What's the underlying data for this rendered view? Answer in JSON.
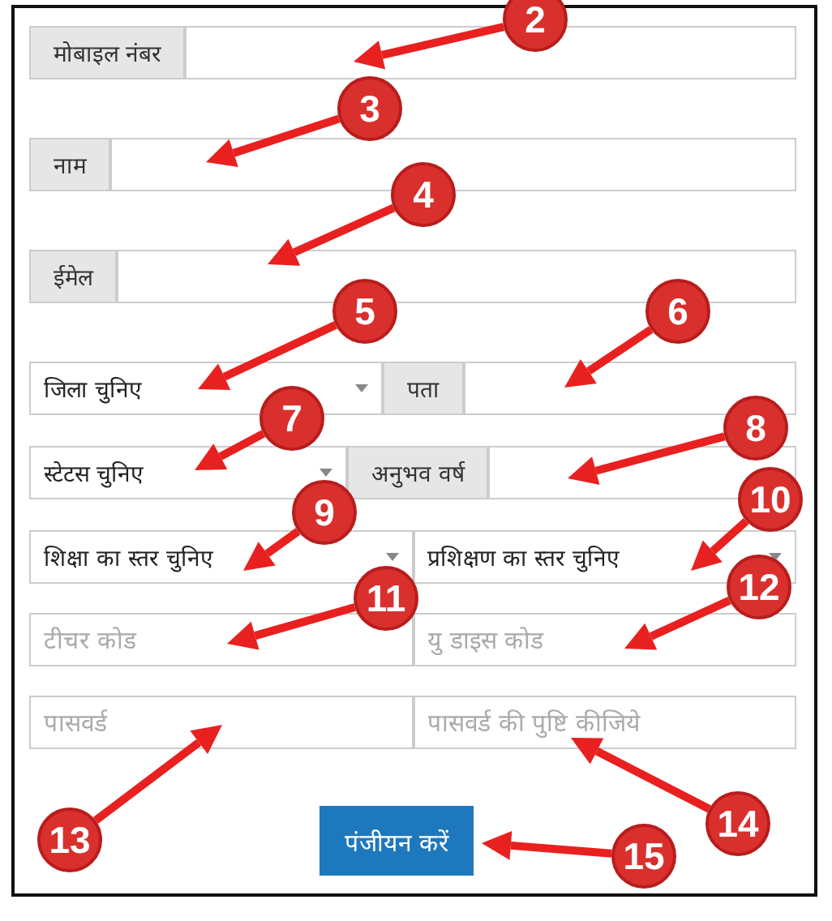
{
  "rows": [
    [
      {
        "kind": "label",
        "text": "मोबाइल नंबर"
      },
      {
        "kind": "input"
      }
    ],
    [
      {
        "kind": "label",
        "text": "नाम"
      },
      {
        "kind": "input"
      }
    ],
    [
      {
        "kind": "label",
        "text": "ईमेल"
      },
      {
        "kind": "input"
      }
    ],
    [
      {
        "kind": "select",
        "text": "जिला चुनिए"
      },
      {
        "kind": "label",
        "text": "पता"
      },
      {
        "kind": "input"
      }
    ],
    [
      {
        "kind": "select",
        "text": "स्टेटस चुनिए"
      },
      {
        "kind": "label",
        "text": "अनुभव वर्ष"
      },
      {
        "kind": "input"
      }
    ],
    [
      {
        "kind": "select",
        "text": "शिक्षा का स्तर चुनिए"
      },
      {
        "kind": "select",
        "text": "प्रशिक्षण का स्तर चुनिए"
      }
    ],
    [
      {
        "kind": "input",
        "placeholder": "टीचर कोड"
      },
      {
        "kind": "input",
        "placeholder": "यु डाइस कोड"
      }
    ],
    [
      {
        "kind": "input",
        "placeholder": "पासवर्ड"
      },
      {
        "kind": "input",
        "placeholder": "पासवर्ड की पुष्टि कीजिये"
      }
    ]
  ],
  "button": {
    "label": "पंजीयन करें"
  },
  "annotations": [
    {
      "number": "2"
    },
    {
      "number": "3"
    },
    {
      "number": "4"
    },
    {
      "number": "5"
    },
    {
      "number": "6"
    },
    {
      "number": "7"
    },
    {
      "number": "8"
    },
    {
      "number": "9"
    },
    {
      "number": "10"
    },
    {
      "number": "11"
    },
    {
      "number": "12"
    },
    {
      "number": "13"
    },
    {
      "number": "14"
    },
    {
      "number": "15"
    }
  ]
}
